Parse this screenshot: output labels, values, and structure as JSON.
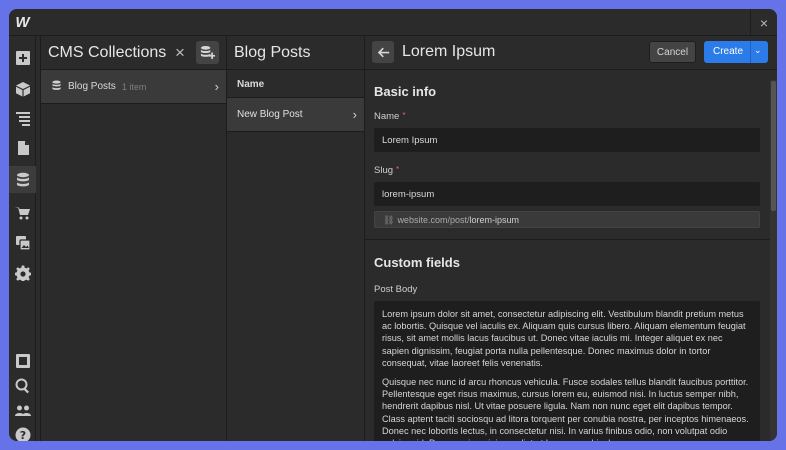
{
  "window": {
    "logo": "W",
    "close": "×"
  },
  "rail": {
    "icons": [
      "add-icon",
      "box-icon",
      "navigator-icon",
      "pages-icon",
      "cms-icon",
      "ecommerce-icon",
      "assets-icon",
      "settings-icon",
      "preview-icon",
      "search-icon",
      "users-icon",
      "help-icon"
    ],
    "active": "cms-icon"
  },
  "collections": {
    "title": "CMS Collections",
    "close": "×",
    "items": [
      {
        "name": "Blog Posts",
        "count": "1 item"
      }
    ]
  },
  "posts": {
    "title": "Blog Posts",
    "column_header": "Name",
    "items": [
      {
        "name": "New Blog Post"
      }
    ]
  },
  "editor": {
    "title": "Lorem Ipsum",
    "cancel_label": "Cancel",
    "create_label": "Create",
    "basic_info": {
      "title": "Basic info",
      "name_label": "Name",
      "name_value": "Lorem Ipsum",
      "slug_label": "Slug",
      "slug_value": "lorem-ipsum",
      "url_prefix": "website.com/post/",
      "url_slug": "lorem-ipsum",
      "required_mark": "*"
    },
    "custom_fields": {
      "title": "Custom fields",
      "post_body_label": "Post Body",
      "paragraphs": [
        "Lorem ipsum dolor sit amet, consectetur adipiscing elit. Vestibulum blandit pretium metus ac lobortis. Quisque vel iaculis ex. Aliquam quis cursus libero. Aliquam elementum feugiat risus, sit amet mollis lacus faucibus ut. Donec vitae iaculis mi. Integer aliquet ex nec sapien dignissim, feugiat porta nulla pellentesque. Donec maximus dolor in tortor consequat, vitae laoreet felis venenatis.",
        "Quisque nec nunc id arcu rhoncus vehicula. Fusce sodales tellus blandit faucibus porttitor. Pellentesque eget risus maximus, cursus lorem eu, euismod nisi. In luctus semper nibh, hendrerit dapibus nisl. Ut vitae posuere ligula. Nam non nunc eget elit dapibus tempor. Class aptent taciti sociosqu ad litora torquent per conubia nostra, per inceptos himenaeos. Donec nec lobortis lectus, in consectetur nisi. In varius finibus odio, non volutpat odio pulvinar id. Donec enim mi, imperdiet ut lorem a, vehicula"
      ]
    }
  },
  "colors": {
    "accent": "#2b7be8",
    "background": "#6673e8",
    "panel": "#2b2b2b",
    "required": "#e26464"
  }
}
